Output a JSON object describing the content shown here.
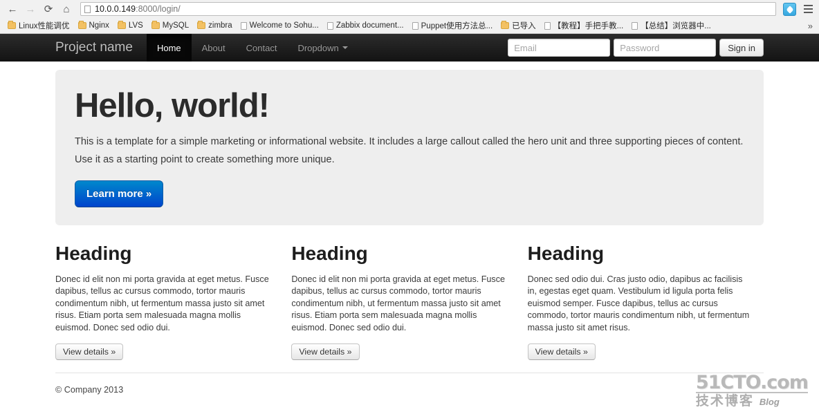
{
  "browser": {
    "back_icon": "back-arrow-icon",
    "forward_icon": "forward-arrow-icon",
    "reload_icon": "reload-icon",
    "home_icon": "home-icon",
    "url_host": "10.0.0.149",
    "url_rest": ":8000/login/",
    "extension_icon": "edit-extension-icon",
    "menu_icon": "hamburger-menu-icon",
    "bookmarks_overflow": "»",
    "bookmarks": [
      {
        "label": "Linux性能调优",
        "type": "folder"
      },
      {
        "label": "Nginx",
        "type": "folder"
      },
      {
        "label": "LVS",
        "type": "folder"
      },
      {
        "label": "MySQL",
        "type": "folder"
      },
      {
        "label": "zimbra",
        "type": "folder"
      },
      {
        "label": "Welcome to Sohu...",
        "type": "page"
      },
      {
        "label": "Zabbix document...",
        "type": "page"
      },
      {
        "label": "Puppet使用方法总...",
        "type": "page"
      },
      {
        "label": "已导入",
        "type": "folder"
      },
      {
        "label": "【教程】手把手教...",
        "type": "page"
      },
      {
        "label": "【总结】浏览器中...",
        "type": "page"
      }
    ]
  },
  "navbar": {
    "brand": "Project name",
    "links": [
      {
        "label": "Home",
        "active": true
      },
      {
        "label": "About",
        "active": false
      },
      {
        "label": "Contact",
        "active": false
      },
      {
        "label": "Dropdown",
        "active": false,
        "caret": true
      }
    ],
    "email_placeholder": "Email",
    "email_value": "",
    "password_placeholder": "Password",
    "password_value": "",
    "signin_label": "Sign in"
  },
  "hero": {
    "title": "Hello, world!",
    "lead": "This is a template for a simple marketing or informational website. It includes a large callout called the hero unit and three supporting pieces of content. Use it as a starting point to create something more unique.",
    "button_label": "Learn more »"
  },
  "columns": [
    {
      "heading": "Heading",
      "body": "Donec id elit non mi porta gravida at eget metus. Fusce dapibus, tellus ac cursus commodo, tortor mauris condimentum nibh, ut fermentum massa justo sit amet risus. Etiam porta sem malesuada magna mollis euismod. Donec sed odio dui.",
      "button_label": "View details »"
    },
    {
      "heading": "Heading",
      "body": "Donec id elit non mi porta gravida at eget metus. Fusce dapibus, tellus ac cursus commodo, tortor mauris condimentum nibh, ut fermentum massa justo sit amet risus. Etiam porta sem malesuada magna mollis euismod. Donec sed odio dui.",
      "button_label": "View details »"
    },
    {
      "heading": "Heading",
      "body": "Donec sed odio dui. Cras justo odio, dapibus ac facilisis in, egestas eget quam. Vestibulum id ligula porta felis euismod semper. Fusce dapibus, tellus ac cursus commodo, tortor mauris condimentum nibh, ut fermentum massa justo sit amet risus.",
      "button_label": "View details »"
    }
  ],
  "footer": {
    "copyright": "© Company 2013"
  },
  "watermark": {
    "top": "51CTO.com",
    "bottom_cn": "技术博客",
    "bottom_en": "Blog"
  },
  "colors": {
    "navbar_dark": "#1b1b1b",
    "hero_bg": "#eeeeee",
    "primary_button": "#0077cc",
    "bookmark_folder": "#f3c163"
  }
}
